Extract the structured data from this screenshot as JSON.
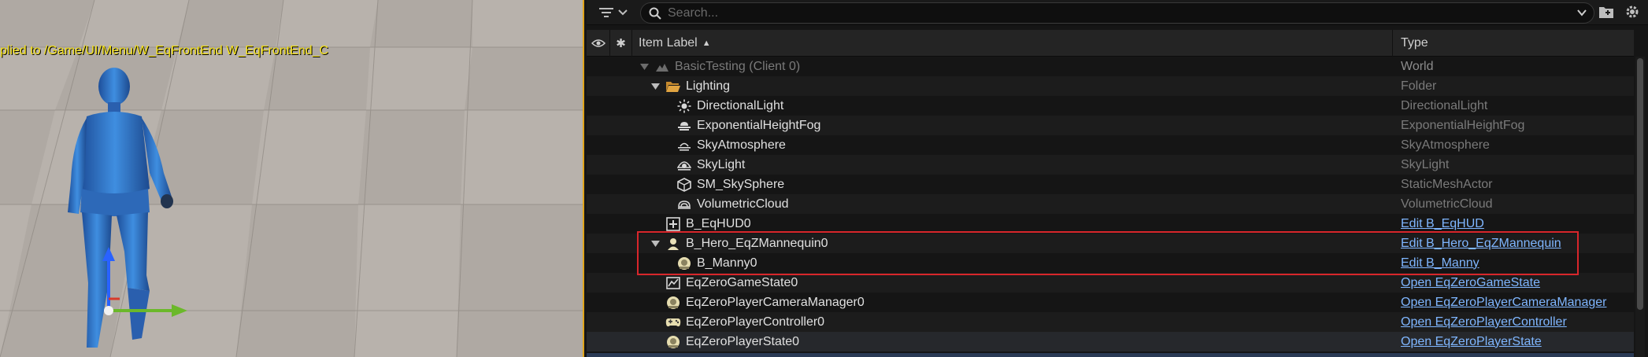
{
  "viewport": {
    "message": "plied to /Game/UI/Menu/W_EqFrontEnd W_EqFrontEnd_C"
  },
  "outliner": {
    "search": {
      "placeholder": "Search..."
    },
    "columns": {
      "item_label": "Item Label",
      "type": "Type"
    },
    "rows": [
      {
        "label": "BasicTesting (Client 0)",
        "type": "World",
        "icon": "world-icon",
        "indent": 0,
        "expanded": true
      },
      {
        "label": "Lighting",
        "type": "Folder",
        "icon": "folder-open-icon",
        "indent": 1,
        "expanded": true
      },
      {
        "label": "DirectionalLight",
        "type": "DirectionalLight",
        "icon": "sun-icon",
        "indent": 2
      },
      {
        "label": "ExponentialHeightFog",
        "type": "ExponentialHeightFog",
        "icon": "fog-icon",
        "indent": 2
      },
      {
        "label": "SkyAtmosphere",
        "type": "SkyAtmosphere",
        "icon": "sky-atmosphere-icon",
        "indent": 2
      },
      {
        "label": "SkyLight",
        "type": "SkyLight",
        "icon": "skylight-icon",
        "indent": 2
      },
      {
        "label": "SM_SkySphere",
        "type": "StaticMeshActor",
        "icon": "static-mesh-icon",
        "indent": 2
      },
      {
        "label": "VolumetricCloud",
        "type": "VolumetricCloud",
        "icon": "cloud-icon",
        "indent": 2
      },
      {
        "label": "B_EqHUD0",
        "type": "Edit B_EqHUD",
        "icon": "hud-icon",
        "indent": 1,
        "link": true
      },
      {
        "label": "B_Hero_EqZMannequin0",
        "type": "Edit B_Hero_EqZMannequin",
        "icon": "pawn-icon",
        "indent": 1,
        "link": true,
        "expanded": true
      },
      {
        "label": "B_Manny0",
        "type": "Edit B_Manny",
        "icon": "actor-icon",
        "indent": 2,
        "link": true
      },
      {
        "label": "EqZeroGameState0",
        "type": "Open EqZeroGameState",
        "icon": "game-state-icon",
        "indent": 1,
        "link": true
      },
      {
        "label": "EqZeroPlayerCameraManager0",
        "type": "Open EqZeroPlayerCameraManager",
        "icon": "actor-icon",
        "indent": 1,
        "link": true
      },
      {
        "label": "EqZeroPlayerController0",
        "type": "Open EqZeroPlayerController",
        "icon": "gamepad-icon",
        "indent": 1,
        "link": true
      },
      {
        "label": "EqZeroPlayerState0",
        "type": "Open EqZeroPlayerState",
        "icon": "actor-icon",
        "indent": 1,
        "link": true
      }
    ]
  },
  "colors": {
    "link": "#7fb6ff",
    "highlight_box": "#d8262b",
    "viewport_border": "#e0a51c",
    "viewport_message": "#f5e21a"
  }
}
